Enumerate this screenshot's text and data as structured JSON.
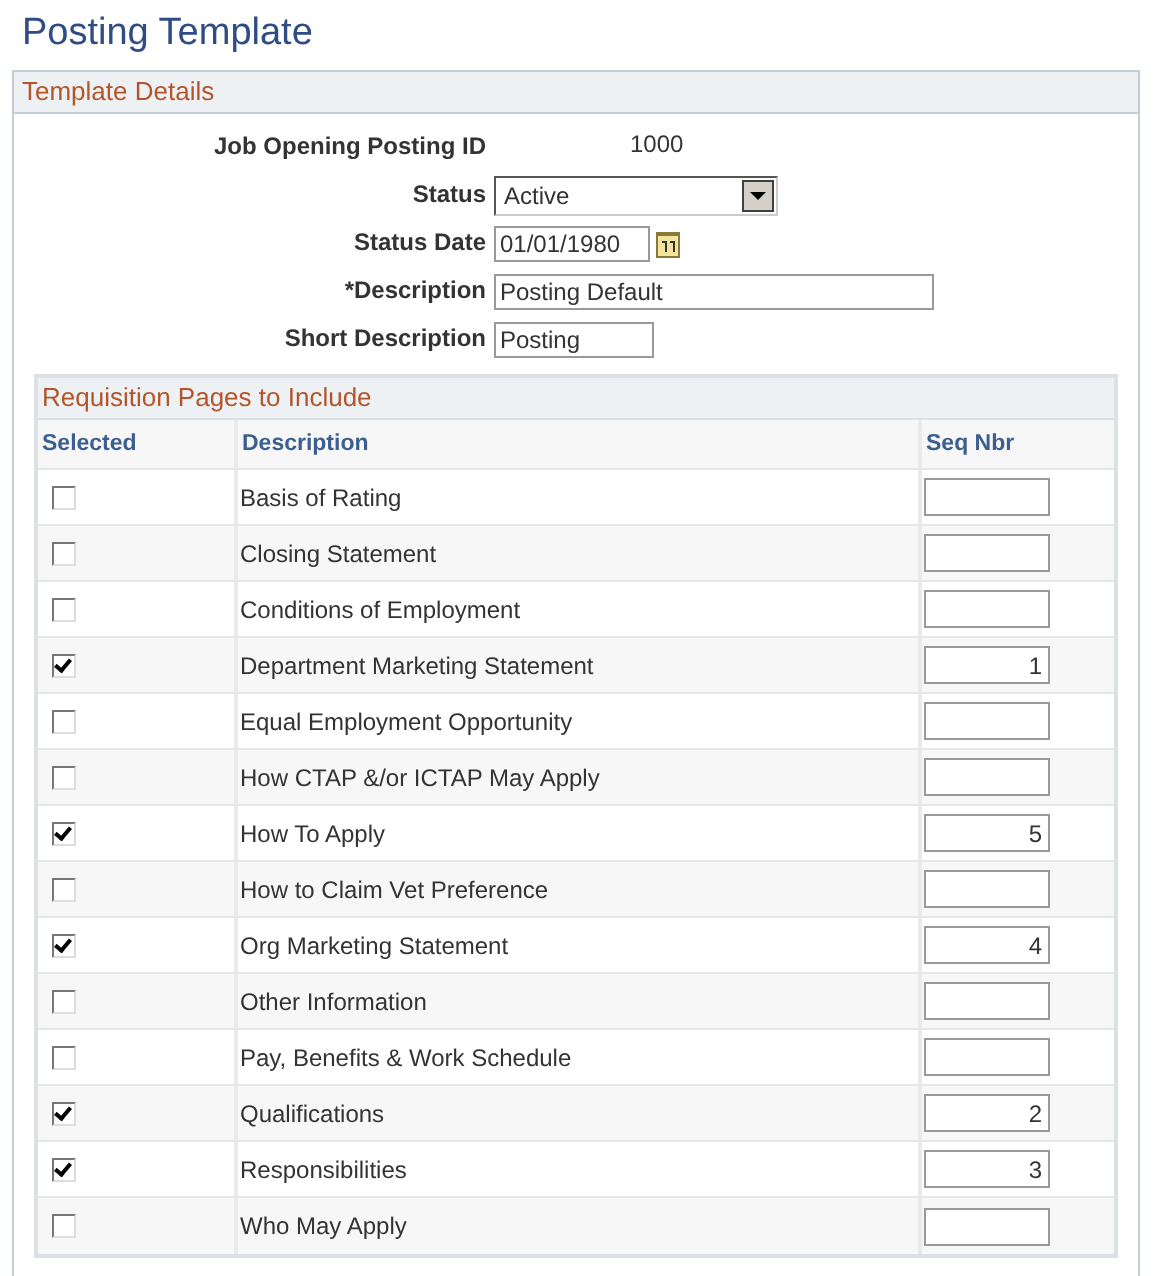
{
  "page_title": "Posting Template",
  "template_details": {
    "title": "Template Details",
    "job_opening_posting_id": {
      "label": "Job Opening Posting ID",
      "value": "1000"
    },
    "status": {
      "label": "Status",
      "value": "Active"
    },
    "status_date": {
      "label": "Status Date",
      "value": "01/01/1980"
    },
    "description": {
      "label": "*Description",
      "value": "Posting Default"
    },
    "short_description": {
      "label": "Short Description",
      "value": "Posting"
    }
  },
  "requisition_pages": {
    "title": "Requisition Pages to Include",
    "columns": [
      "Selected",
      "Description",
      "Seq Nbr"
    ],
    "rows": [
      {
        "checked": false,
        "description": "Basis of Rating",
        "seq_nbr": ""
      },
      {
        "checked": false,
        "description": "Closing Statement",
        "seq_nbr": ""
      },
      {
        "checked": false,
        "description": "Conditions of Employment",
        "seq_nbr": ""
      },
      {
        "checked": true,
        "description": "Department Marketing Statement",
        "seq_nbr": "1"
      },
      {
        "checked": false,
        "description": "Equal Employment Opportunity",
        "seq_nbr": ""
      },
      {
        "checked": false,
        "description": "How CTAP &/or ICTAP May Apply",
        "seq_nbr": ""
      },
      {
        "checked": true,
        "description": "How To Apply",
        "seq_nbr": "5"
      },
      {
        "checked": false,
        "description": "How to Claim Vet Preference",
        "seq_nbr": ""
      },
      {
        "checked": true,
        "description": "Org Marketing Statement",
        "seq_nbr": "4"
      },
      {
        "checked": false,
        "description": "Other Information",
        "seq_nbr": ""
      },
      {
        "checked": false,
        "description": "Pay, Benefits & Work Schedule",
        "seq_nbr": ""
      },
      {
        "checked": true,
        "description": "Qualifications",
        "seq_nbr": "2"
      },
      {
        "checked": true,
        "description": "Responsibilities",
        "seq_nbr": "3"
      },
      {
        "checked": false,
        "description": "Who May Apply",
        "seq_nbr": ""
      }
    ]
  }
}
